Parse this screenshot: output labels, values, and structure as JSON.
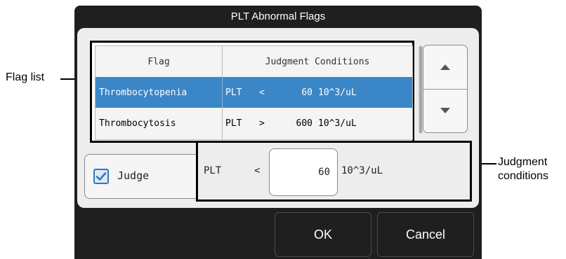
{
  "dialog": {
    "title": "PLT Abnormal Flags"
  },
  "flag_table": {
    "headers": {
      "flag": "Flag",
      "conditions": "Judgment Conditions"
    },
    "rows": [
      {
        "flag": "Thrombocytopenia",
        "param": "PLT",
        "op": "<",
        "value": "60",
        "unit": "10^3/uL",
        "selected": true
      },
      {
        "flag": "Thrombocytosis",
        "param": "PLT",
        "op": ">",
        "value": "600",
        "unit": "10^3/uL",
        "selected": false
      }
    ]
  },
  "scroll": {
    "up_icon": "triangle-up-icon",
    "down_icon": "triangle-down-icon"
  },
  "judge": {
    "label": "Judge",
    "checked": true
  },
  "condition_editor": {
    "param": "PLT",
    "op": "<",
    "value": "60",
    "unit": "10^3/uL"
  },
  "buttons": {
    "ok": "OK",
    "cancel": "Cancel"
  },
  "callouts": {
    "flag_list": "Flag list",
    "judgment_line1": "Judgment",
    "judgment_line2": "conditions"
  },
  "colors": {
    "dialog_bg": "#1f1f1f",
    "panel_bg": "#ededed",
    "selected_row": "#3b86c7",
    "checkbox_accent": "#2f77c7"
  }
}
